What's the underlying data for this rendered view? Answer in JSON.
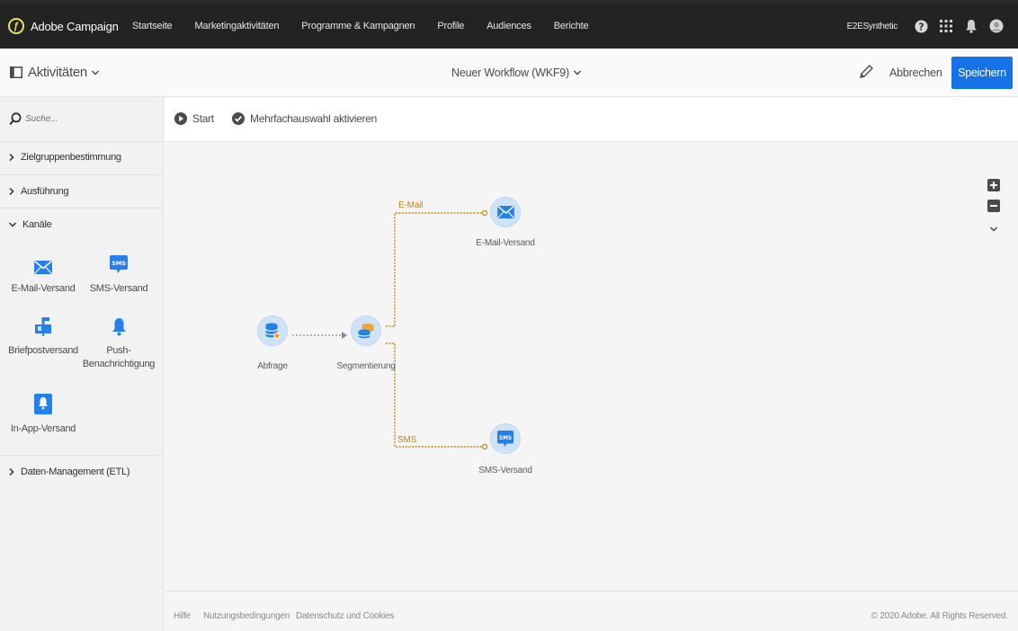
{
  "app": {
    "brand": "Adobe Campaign",
    "nav": [
      "Startseite",
      "Marketingaktivitäten",
      "Programme & Kampagnen",
      "Profile",
      "Audiences",
      "Berichte"
    ],
    "org": "E2ESynthetic"
  },
  "header": {
    "activities_label": "Aktivitäten",
    "workflow_title": "Neuer Workflow (WKF9)",
    "cancel_label": "Abbrechen",
    "save_label": "Speichern"
  },
  "sidebar": {
    "search_placeholder": "Suche...",
    "categories": {
      "targeting": "Zielgruppenbestimmung",
      "execution": "Ausführung",
      "channels": "Kanäle",
      "data_management": "Daten-Management (ETL)"
    },
    "channel_tiles": {
      "email": "E-Mail-Versand",
      "sms": "SMS-Versand",
      "direct_mail": "Briefpostversand",
      "push_line1": "Push-",
      "push_line2": "Benachrichtigung",
      "inapp": "In-App-Versand"
    }
  },
  "toolbar": {
    "start_label": "Start",
    "multiselect_label": "Mehrfachauswahl aktivieren"
  },
  "workflow": {
    "nodes": {
      "query": "Abfrage",
      "segmentation": "Segmentierung",
      "email": "E-Mail-Versand",
      "sms": "SMS-Versand"
    },
    "transitions": {
      "email": "E-Mail",
      "sms": "SMS"
    }
  },
  "footer": {
    "help": "Hilfe",
    "terms": "Nutzungsbedingungen",
    "privacy": "Datenschutz und Cookies",
    "copyright": "© 2020 Adobe. All Rights Reserved."
  },
  "colors": {
    "primary": "#1473e6",
    "topbar": "#232323",
    "node_bg": "#cfe3f8",
    "transition": "#c7860c",
    "icon_blue": "#2680eb"
  }
}
